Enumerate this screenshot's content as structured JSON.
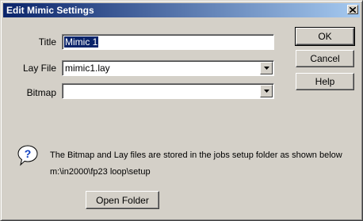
{
  "window": {
    "title": "Edit Mimic Settings"
  },
  "form": {
    "title_label": "Title",
    "title_value": "Mimic 1",
    "lay_file_label": "Lay File",
    "lay_file_value": "mimic1.lay",
    "bitmap_label": "Bitmap",
    "bitmap_value": ""
  },
  "buttons": {
    "ok": "OK",
    "cancel": "Cancel",
    "help": "Help",
    "open_folder": "Open Folder"
  },
  "info": {
    "message": "The Bitmap and Lay files are stored in the jobs setup folder as shown below",
    "path": "m:\\in2000\\fp23 loop\\setup",
    "icon": "question-icon"
  },
  "colors": {
    "titlebar_start": "#0a246a",
    "titlebar_end": "#a6caf0",
    "face": "#d4d0c8"
  }
}
